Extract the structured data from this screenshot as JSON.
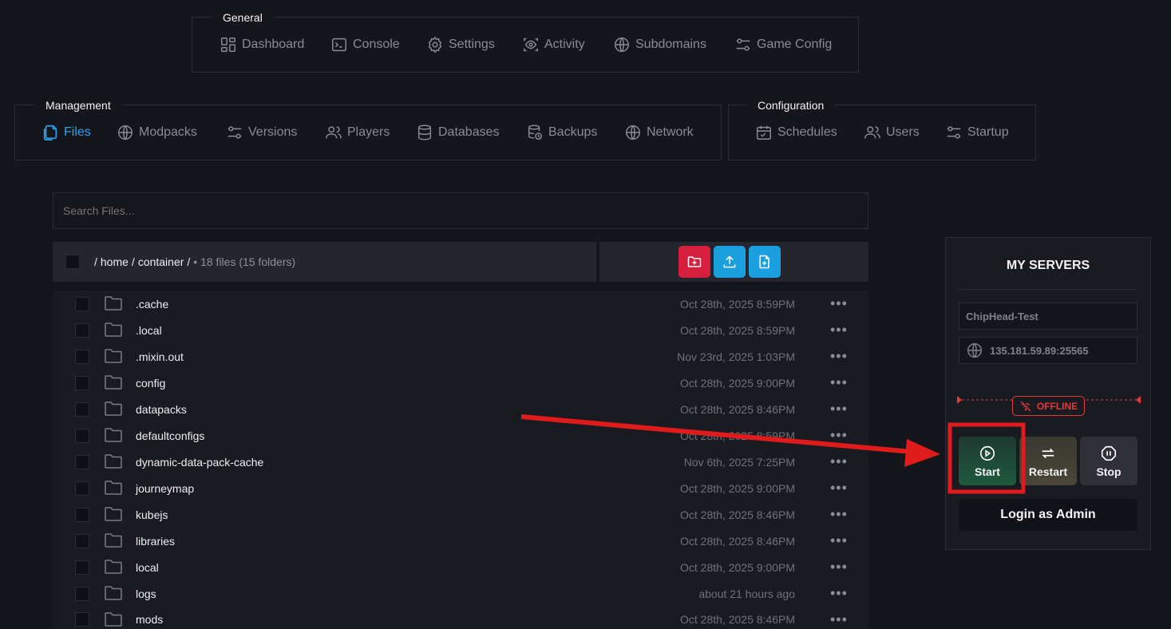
{
  "nav": {
    "general": {
      "label": "General",
      "items": [
        {
          "label": "Dashboard",
          "icon": "dashboard-icon"
        },
        {
          "label": "Console",
          "icon": "console-icon"
        },
        {
          "label": "Settings",
          "icon": "gear-icon"
        },
        {
          "label": "Activity",
          "icon": "eye-icon"
        },
        {
          "label": "Subdomains",
          "icon": "globe-icon"
        },
        {
          "label": "Game Config",
          "icon": "sliders-icon"
        }
      ]
    },
    "management": {
      "label": "Management",
      "items": [
        {
          "label": "Files",
          "icon": "files-icon",
          "active": true
        },
        {
          "label": "Modpacks",
          "icon": "globe-icon"
        },
        {
          "label": "Versions",
          "icon": "sliders-icon"
        },
        {
          "label": "Players",
          "icon": "users-icon"
        },
        {
          "label": "Databases",
          "icon": "database-icon"
        },
        {
          "label": "Backups",
          "icon": "backup-icon"
        },
        {
          "label": "Network",
          "icon": "globe-icon"
        }
      ]
    },
    "configuration": {
      "label": "Configuration",
      "items": [
        {
          "label": "Schedules",
          "icon": "calendar-icon"
        },
        {
          "label": "Users",
          "icon": "users-icon"
        },
        {
          "label": "Startup",
          "icon": "sliders-icon"
        }
      ]
    }
  },
  "search": {
    "placeholder": "Search Files..."
  },
  "path": {
    "segments": [
      "/",
      "home",
      "/",
      "container",
      "/"
    ],
    "summary": "• 18 files (15 folders)"
  },
  "actions": {
    "new_folder_color": "#d61f3f",
    "upload_color": "#1aa0e0",
    "new_file_color": "#1aa0e0"
  },
  "files": [
    {
      "name": ".cache",
      "date": "Oct 28th, 2025 8:59PM"
    },
    {
      "name": ".local",
      "date": "Oct 28th, 2025 8:59PM"
    },
    {
      "name": ".mixin.out",
      "date": "Nov 23rd, 2025 1:03PM"
    },
    {
      "name": "config",
      "date": "Oct 28th, 2025 9:00PM"
    },
    {
      "name": "datapacks",
      "date": "Oct 28th, 2025 8:46PM"
    },
    {
      "name": "defaultconfigs",
      "date": "Oct 28th, 2025 8:59PM"
    },
    {
      "name": "dynamic-data-pack-cache",
      "date": "Nov 6th, 2025 7:25PM"
    },
    {
      "name": "journeymap",
      "date": "Oct 28th, 2025 9:00PM"
    },
    {
      "name": "kubejs",
      "date": "Oct 28th, 2025 8:46PM"
    },
    {
      "name": "libraries",
      "date": "Oct 28th, 2025 8:46PM"
    },
    {
      "name": "local",
      "date": "Oct 28th, 2025 9:00PM"
    },
    {
      "name": "logs",
      "date": "about 21 hours ago"
    },
    {
      "name": "mods",
      "date": "Oct 28th, 2025 8:46PM"
    }
  ],
  "more_glyph": "•••",
  "server_panel": {
    "title": "MY SERVERS",
    "server_name": "ChipHead-Test",
    "address": "135.181.59.89:25565",
    "status": "OFFLINE",
    "status_color": "#e03a3a",
    "start_label": "Start",
    "restart_label": "Restart",
    "stop_label": "Stop",
    "login_label": "Login as Admin"
  },
  "annotation": {
    "color": "#e01b1b"
  }
}
